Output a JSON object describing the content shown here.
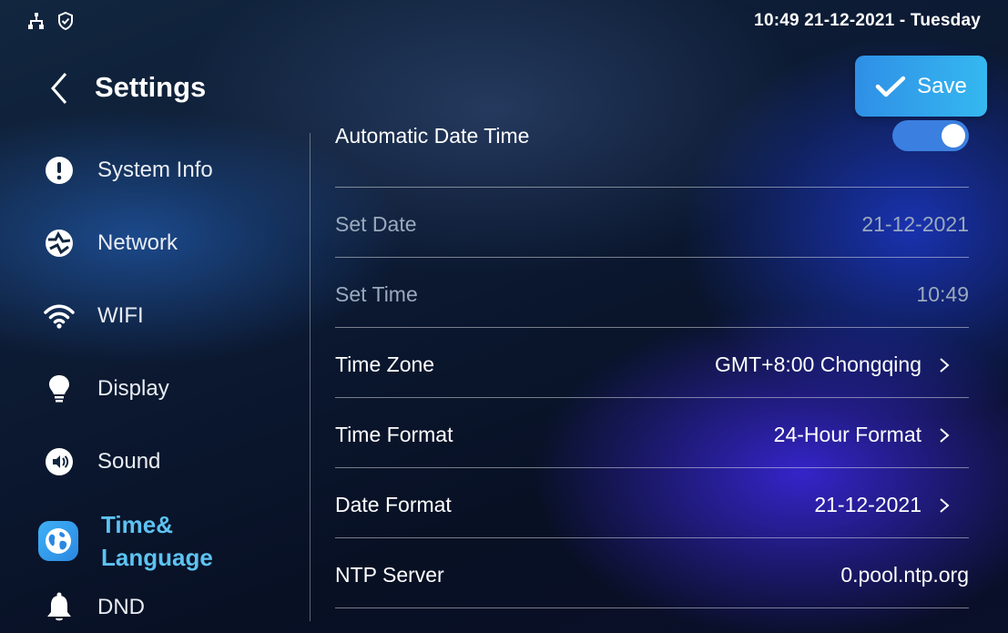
{
  "status_bar": {
    "icons": [
      "network-topology-icon",
      "shield-check-icon"
    ],
    "datetime": "10:49  21-12-2021 - Tuesday"
  },
  "header": {
    "title": "Settings",
    "back_icon": "chevron-left-icon",
    "save_label": "Save"
  },
  "sidebar": {
    "items": [
      {
        "label": "System Info",
        "icon": "exclamation-circle-icon"
      },
      {
        "label": "Network",
        "icon": "globe-network-icon"
      },
      {
        "label": "WIFI",
        "icon": "wifi-icon"
      },
      {
        "label": "Display",
        "icon": "lightbulb-icon"
      },
      {
        "label": "Sound",
        "icon": "speaker-icon"
      },
      {
        "label_line1": "Time&",
        "label_line2": "Language",
        "icon": "globe-icon",
        "active": true
      },
      {
        "label": "DND",
        "icon": "bell-icon"
      }
    ]
  },
  "content": {
    "rows": [
      {
        "label": "Automatic Date Time",
        "toggle": true
      },
      {
        "label": "Set Date",
        "value": "21-12-2021"
      },
      {
        "label": "Set Time",
        "value": "10:49"
      },
      {
        "label": "Time Zone",
        "value": "GMT+8:00 Chongqing"
      },
      {
        "label": "Time Format",
        "value": "24-Hour Format"
      },
      {
        "label": "Date Format",
        "value": "21-12-2021"
      },
      {
        "label": "NTP Server",
        "value": "0.pool.ntp.org"
      }
    ]
  },
  "colors": {
    "accent": "#5dc3f2",
    "save_button": "#2f8fe6",
    "toggle_on": "#3b7fe0",
    "disabled_text": "#9aa9bd"
  }
}
